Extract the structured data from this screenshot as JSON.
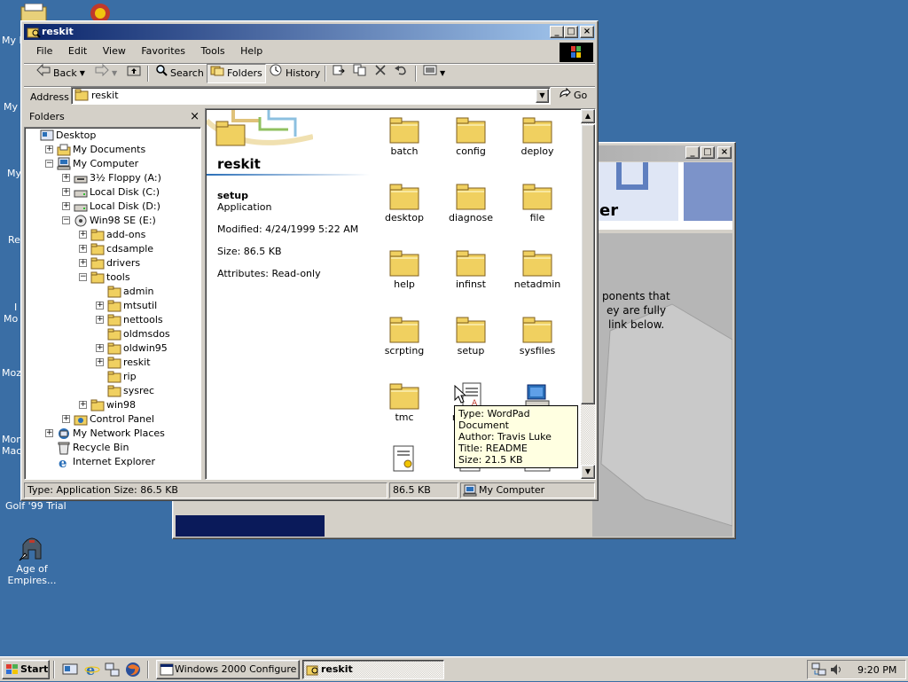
{
  "desktop": {
    "icons": [
      {
        "label": "My D"
      },
      {
        "label": "My"
      },
      {
        "label": "My"
      },
      {
        "label": "Re"
      },
      {
        "label": "I"
      },
      {
        "label": "Mo"
      },
      {
        "label": "Mozi"
      },
      {
        "label": "Mon"
      },
      {
        "label": "Mac"
      },
      {
        "label": "Golf '99 Trial"
      },
      {
        "label": "Age of Empires..."
      }
    ]
  },
  "bg_window": {
    "text_fragment": "er",
    "body_lines": [
      "ponents that",
      "ey are fully",
      "link below."
    ]
  },
  "explorer": {
    "title": "reskit",
    "menu": [
      "File",
      "Edit",
      "View",
      "Favorites",
      "Tools",
      "Help"
    ],
    "toolbar": {
      "back": "Back",
      "search": "Search",
      "folders": "Folders",
      "history": "History"
    },
    "address": {
      "label": "Address",
      "value": "reskit",
      "go": "Go"
    },
    "folders_pane": {
      "title": "Folders",
      "tree": [
        {
          "label": "Desktop",
          "depth": 0,
          "expander": ""
        },
        {
          "label": "My Documents",
          "depth": 1,
          "expander": "+"
        },
        {
          "label": "My Computer",
          "depth": 1,
          "expander": "-"
        },
        {
          "label": "3½ Floppy (A:)",
          "depth": 2,
          "expander": "+"
        },
        {
          "label": "Local Disk (C:)",
          "depth": 2,
          "expander": "+"
        },
        {
          "label": "Local Disk (D:)",
          "depth": 2,
          "expander": "+"
        },
        {
          "label": "Win98 SE (E:)",
          "depth": 2,
          "expander": "-"
        },
        {
          "label": "add-ons",
          "depth": 3,
          "expander": "+"
        },
        {
          "label": "cdsample",
          "depth": 3,
          "expander": "+"
        },
        {
          "label": "drivers",
          "depth": 3,
          "expander": "+"
        },
        {
          "label": "tools",
          "depth": 3,
          "expander": "-"
        },
        {
          "label": "admin",
          "depth": 4,
          "expander": ""
        },
        {
          "label": "mtsutil",
          "depth": 4,
          "expander": "+"
        },
        {
          "label": "nettools",
          "depth": 4,
          "expander": "+"
        },
        {
          "label": "oldmsdos",
          "depth": 4,
          "expander": ""
        },
        {
          "label": "oldwin95",
          "depth": 4,
          "expander": "+"
        },
        {
          "label": "reskit",
          "depth": 4,
          "expander": "+"
        },
        {
          "label": "rip",
          "depth": 4,
          "expander": ""
        },
        {
          "label": "sysrec",
          "depth": 4,
          "expander": ""
        },
        {
          "label": "win98",
          "depth": 3,
          "expander": "+"
        },
        {
          "label": "Control Panel",
          "depth": 2,
          "expander": "+"
        },
        {
          "label": "My Network Places",
          "depth": 1,
          "expander": "+"
        },
        {
          "label": "Recycle Bin",
          "depth": 1,
          "expander": ""
        },
        {
          "label": "Internet Explorer",
          "depth": 1,
          "expander": ""
        }
      ]
    },
    "webview": {
      "folder_title": "reskit",
      "selected_name": "setup",
      "selected_type": "Application",
      "modified": "Modified: 4/24/1999 5:22 AM",
      "size": "Size: 86.5 KB",
      "attributes": "Attributes: Read-only"
    },
    "items": [
      {
        "label": "batch"
      },
      {
        "label": "config"
      },
      {
        "label": "deploy"
      },
      {
        "label": "desktop"
      },
      {
        "label": "diagnose"
      },
      {
        "label": "file"
      },
      {
        "label": "help"
      },
      {
        "label": "infinst"
      },
      {
        "label": "netadmin"
      },
      {
        "label": "scrpting"
      },
      {
        "label": "setup"
      },
      {
        "label": "sysfiles"
      },
      {
        "label": "tmc"
      },
      {
        "label": "readme"
      },
      {
        "label": ""
      }
    ],
    "tooltip": {
      "lines": [
        "Type: WordPad Document",
        "Author: Travis Luke",
        "Title: README",
        "Size: 21.5 KB"
      ]
    },
    "status": {
      "left": "Type: Application Size: 86.5 KB",
      "mid": "86.5 KB",
      "right": "My Computer"
    }
  },
  "taskbar": {
    "start": "Start",
    "tasks": [
      {
        "label": "Windows 2000 Configure ..."
      },
      {
        "label": "reskit"
      }
    ],
    "time": "9:20 PM"
  }
}
